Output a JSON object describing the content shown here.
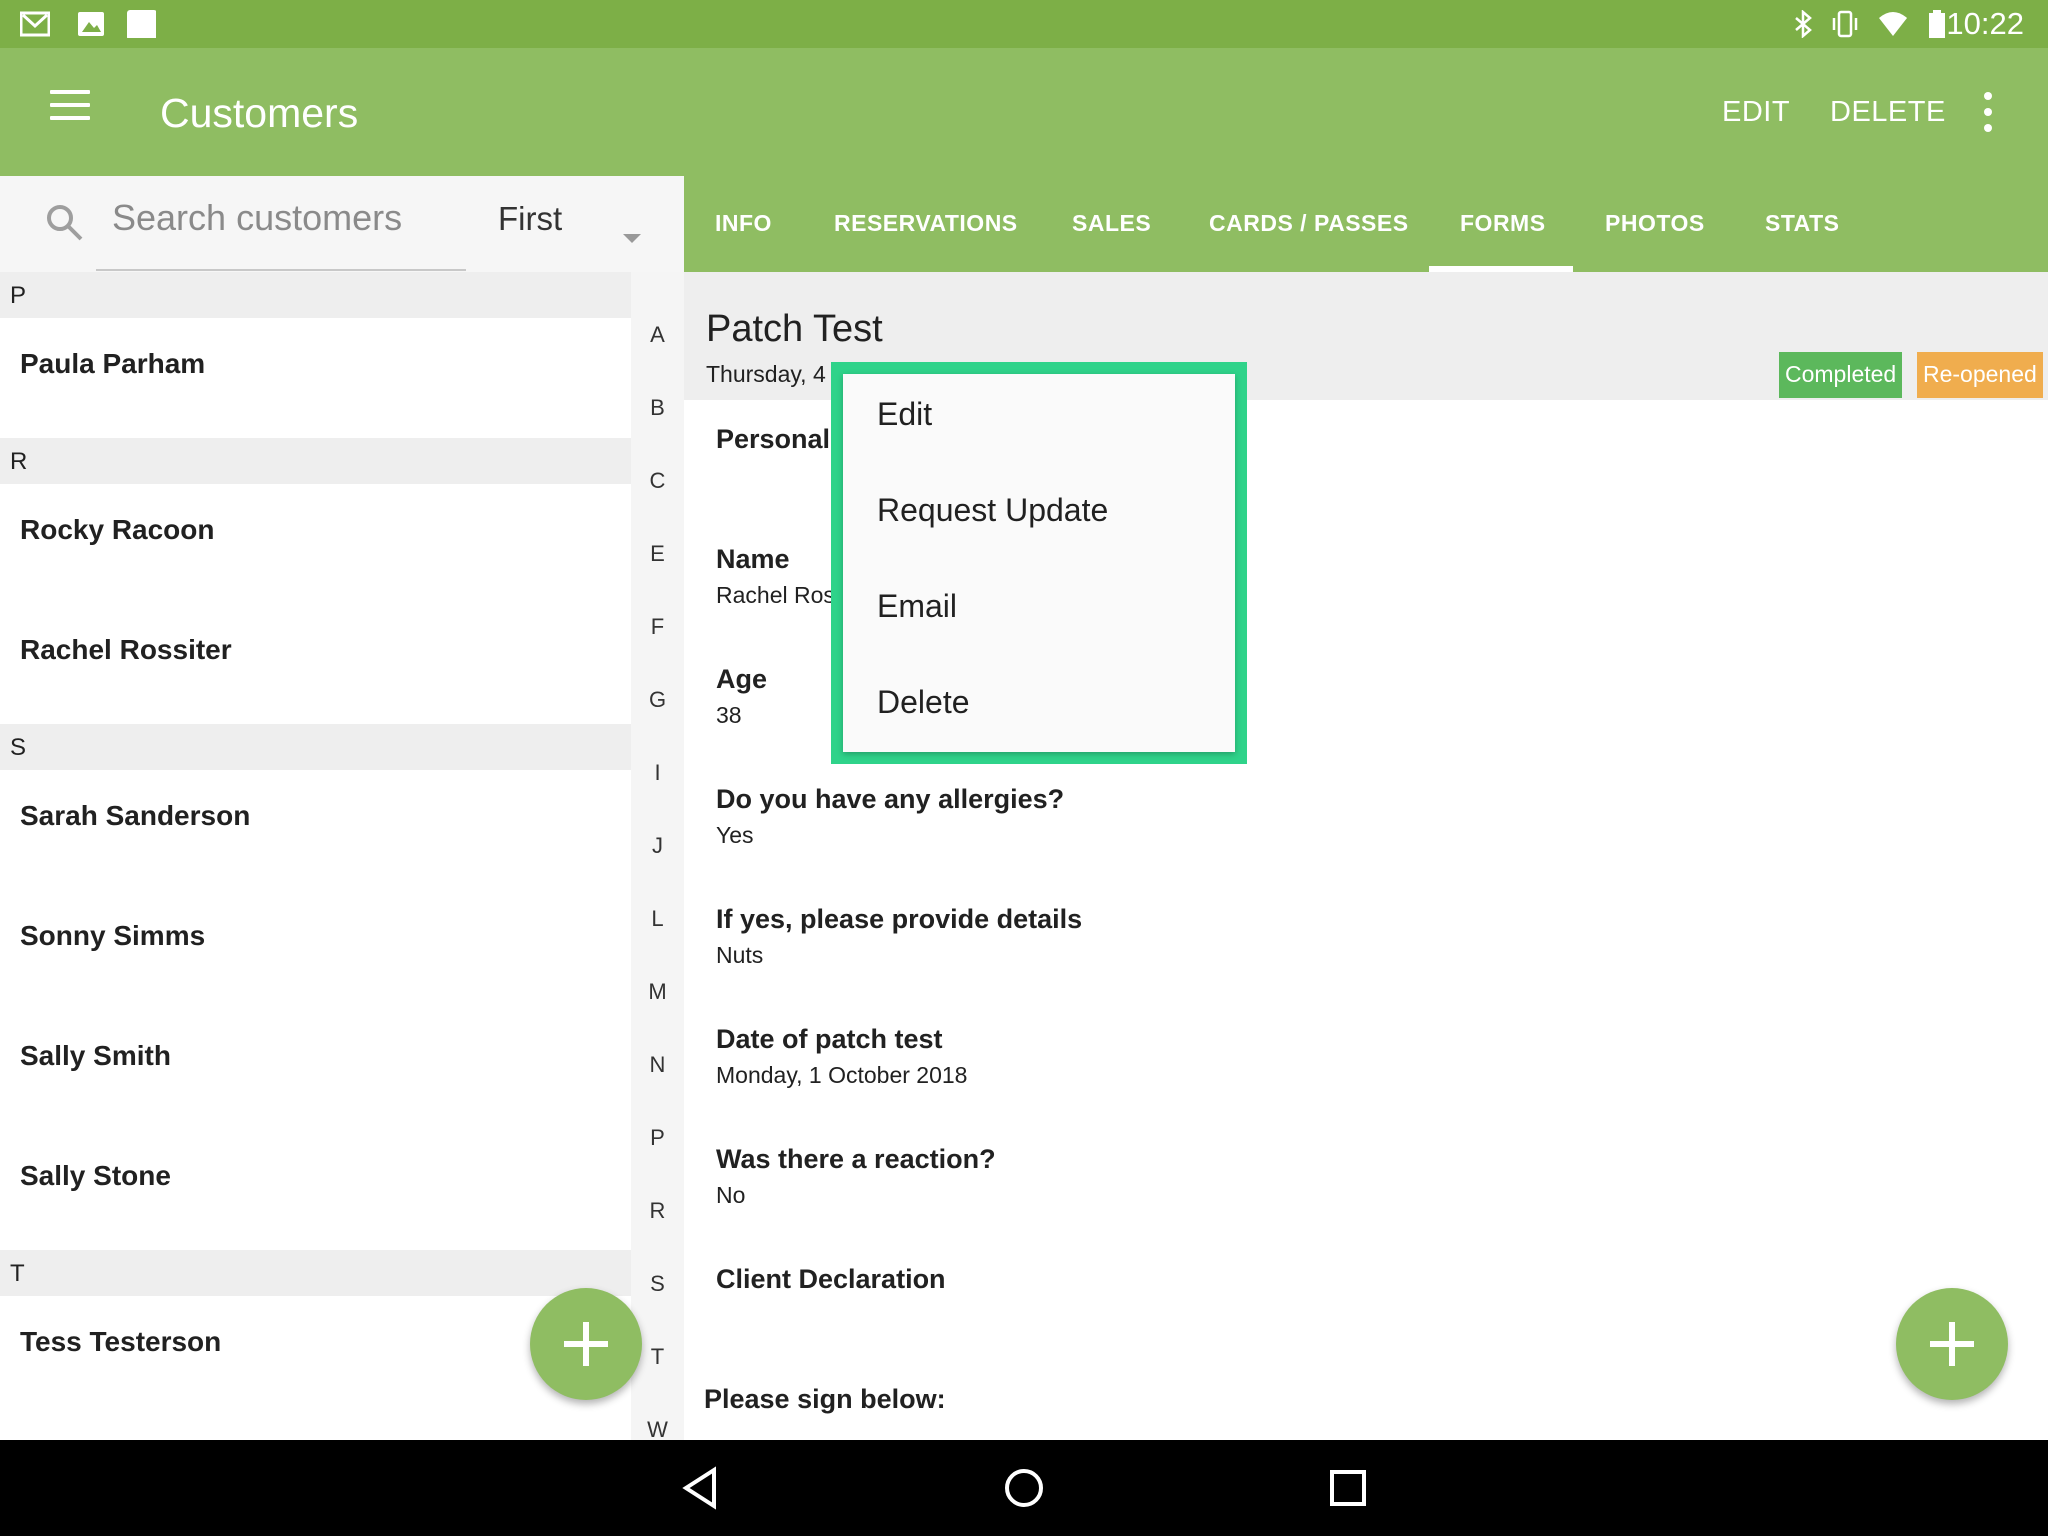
{
  "status_bar": {
    "time": "10:22",
    "left_icons": [
      "gmail-icon",
      "gallery-icon",
      "notification-icon"
    ],
    "right_icons": [
      "bluetooth-icon",
      "vibrate-icon",
      "wifi-icon",
      "battery-icon"
    ]
  },
  "toolbar": {
    "title": "Customers",
    "edit_label": "EDIT",
    "delete_label": "DELETE",
    "accent_color": "#8fbd62"
  },
  "search": {
    "placeholder": "Search customers",
    "sort_value": "First"
  },
  "customer_list": {
    "sections": [
      {
        "letter": "P",
        "customers": [
          "Paula Parham"
        ]
      },
      {
        "letter": "R",
        "customers": [
          "Rocky Racoon",
          "Rachel Rossiter"
        ]
      },
      {
        "letter": "S",
        "customers": [
          "Sarah Sanderson",
          "Sonny Simms",
          "Sally Smith",
          "Sally Stone"
        ]
      },
      {
        "letter": "T",
        "customers": [
          "Tess Testerson"
        ]
      }
    ]
  },
  "alpha_index": [
    "A",
    "B",
    "C",
    "E",
    "F",
    "G",
    "I",
    "J",
    "L",
    "M",
    "N",
    "P",
    "R",
    "S",
    "T",
    "W"
  ],
  "tabs": [
    {
      "label": "INFO"
    },
    {
      "label": "RESERVATIONS"
    },
    {
      "label": "SALES"
    },
    {
      "label": "CARDS / PASSES"
    },
    {
      "label": "FORMS",
      "selected": true
    },
    {
      "label": "PHOTOS"
    },
    {
      "label": "STATS"
    }
  ],
  "form": {
    "title": "Patch Test",
    "date": "Thursday, 4",
    "badges": {
      "completed": "Completed",
      "reopened": "Re-opened",
      "completed_color": "#5cb85c",
      "reopened_color": "#f0ad4e"
    },
    "section": "Personal",
    "fields": [
      {
        "label": "Name",
        "value": "Rachel Ros"
      },
      {
        "label": "Age",
        "value": "38"
      },
      {
        "label": "Do you have any allergies?",
        "value": "Yes"
      },
      {
        "label": "If yes, please provide details",
        "value": "Nuts"
      },
      {
        "label": "Date of patch test",
        "value": "Monday, 1 October 2018"
      },
      {
        "label": "Was there a reaction?",
        "value": "No"
      }
    ],
    "declaration": "Client Declaration",
    "sign_prompt": "Please sign below:"
  },
  "popup_menu": {
    "items": [
      "Edit",
      "Request Update",
      "Email",
      "Delete"
    ],
    "highlight_color": "#2fd38a"
  }
}
